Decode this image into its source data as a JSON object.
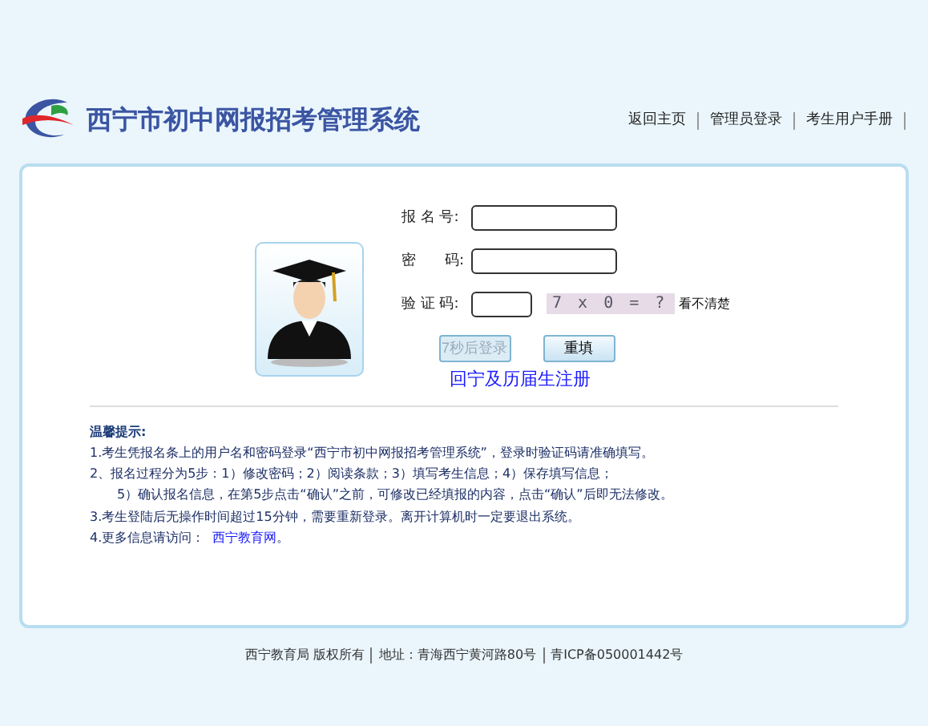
{
  "header": {
    "title": "西宁市初中网报招考管理系统",
    "nav": [
      "返回主页",
      "管理员登录",
      "考生用户手册"
    ]
  },
  "login": {
    "fields": [
      {
        "label": "报 名 号:",
        "kind": "text"
      },
      {
        "label": "密　　码:",
        "kind": "password"
      },
      {
        "label": "验 证 码:",
        "kind": "captcha"
      }
    ],
    "captcha": "7 x 0 = ?",
    "refresh": "看不清楚",
    "buttons": [
      {
        "label": "7秒后登录",
        "disabled": true
      },
      {
        "label": "重填",
        "disabled": false
      }
    ],
    "register": "回宁及历届生注册"
  },
  "tips": {
    "title": "温馨提示:",
    "items": [
      {
        "text": "1.考生凭报名条上的用户名和密码登录“西宁市初中网报招考管理系统”，登录时验证码请准确填写。",
        "indent": false
      },
      {
        "text": "2、报名过程分为5步：1）修改密码；2）阅读条款；3）填写考生信息；4）保存填写信息；",
        "indent": false
      },
      {
        "text": "5）确认报名信息，在第5步点击“确认”之前，可修改已经填报的内容，点击“确认”后即无法修改。",
        "indent": true
      },
      {
        "text": "3.考生登陆后无操作时间超过15分钟，需要重新登录。离开计算机时一定要退出系统。",
        "indent": false
      },
      {
        "text": "4.更多信息请访问：",
        "link": "西宁教育网",
        "tail": "。",
        "indent": false
      }
    ]
  },
  "footer": [
    "西宁教育局 版权所有",
    "地址：青海西宁黄河路80号",
    "青ICP备050001442号"
  ]
}
